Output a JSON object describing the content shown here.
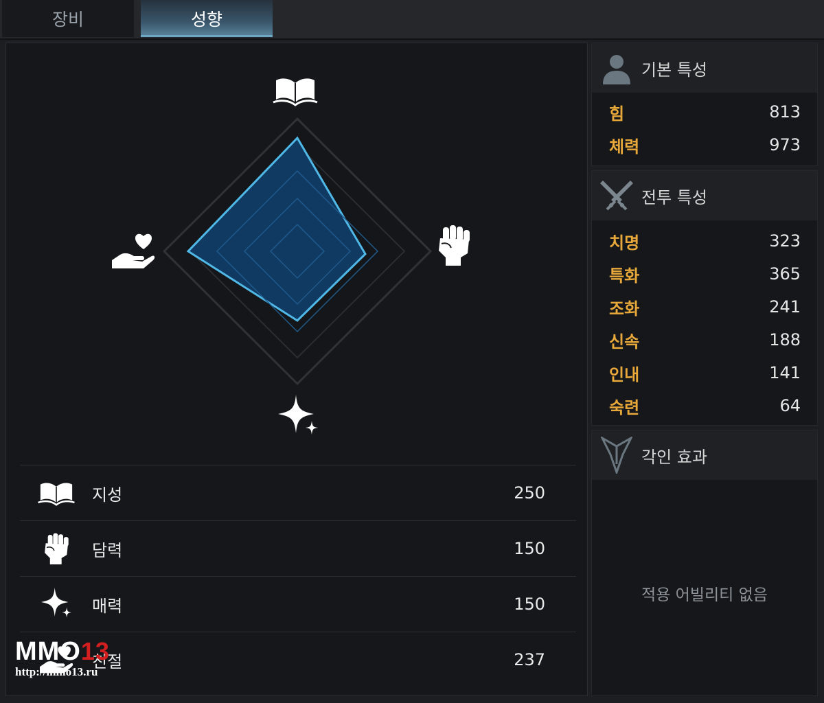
{
  "tabs": [
    {
      "label": "장비",
      "active": false
    },
    {
      "label": "성향",
      "active": true
    }
  ],
  "radar": {
    "icons": [
      "book-icon",
      "fist-icon",
      "sparkle-icon",
      "heart-hand-icon"
    ],
    "accent_color": "#4fb8e6"
  },
  "tendencies": [
    {
      "icon": "book-icon",
      "label": "지성",
      "value": "250"
    },
    {
      "icon": "fist-icon",
      "label": "담력",
      "value": "150"
    },
    {
      "icon": "sparkle-icon",
      "label": "매력",
      "value": "150"
    },
    {
      "icon": "heart-hand-icon",
      "label": "친절",
      "value": "237"
    }
  ],
  "basic_stats": {
    "title": "기본 특성",
    "items": [
      {
        "label": "힘",
        "value": "813"
      },
      {
        "label": "체력",
        "value": "973"
      }
    ]
  },
  "combat_stats": {
    "title": "전투 특성",
    "items": [
      {
        "label": "치명",
        "value": "323"
      },
      {
        "label": "특화",
        "value": "365"
      },
      {
        "label": "조화",
        "value": "241"
      },
      {
        "label": "신속",
        "value": "188"
      },
      {
        "label": "인내",
        "value": "141"
      },
      {
        "label": "숙련",
        "value": "64"
      }
    ]
  },
  "engraving": {
    "title": "각인 효과",
    "empty_text": "적용 어빌리티 없음"
  },
  "watermark": {
    "brand_main": "MMO",
    "brand_number": "13",
    "url": "http://mmo13.ru"
  },
  "colors": {
    "label_gold": "#e8a83a",
    "active_tab": "#5b879f"
  }
}
